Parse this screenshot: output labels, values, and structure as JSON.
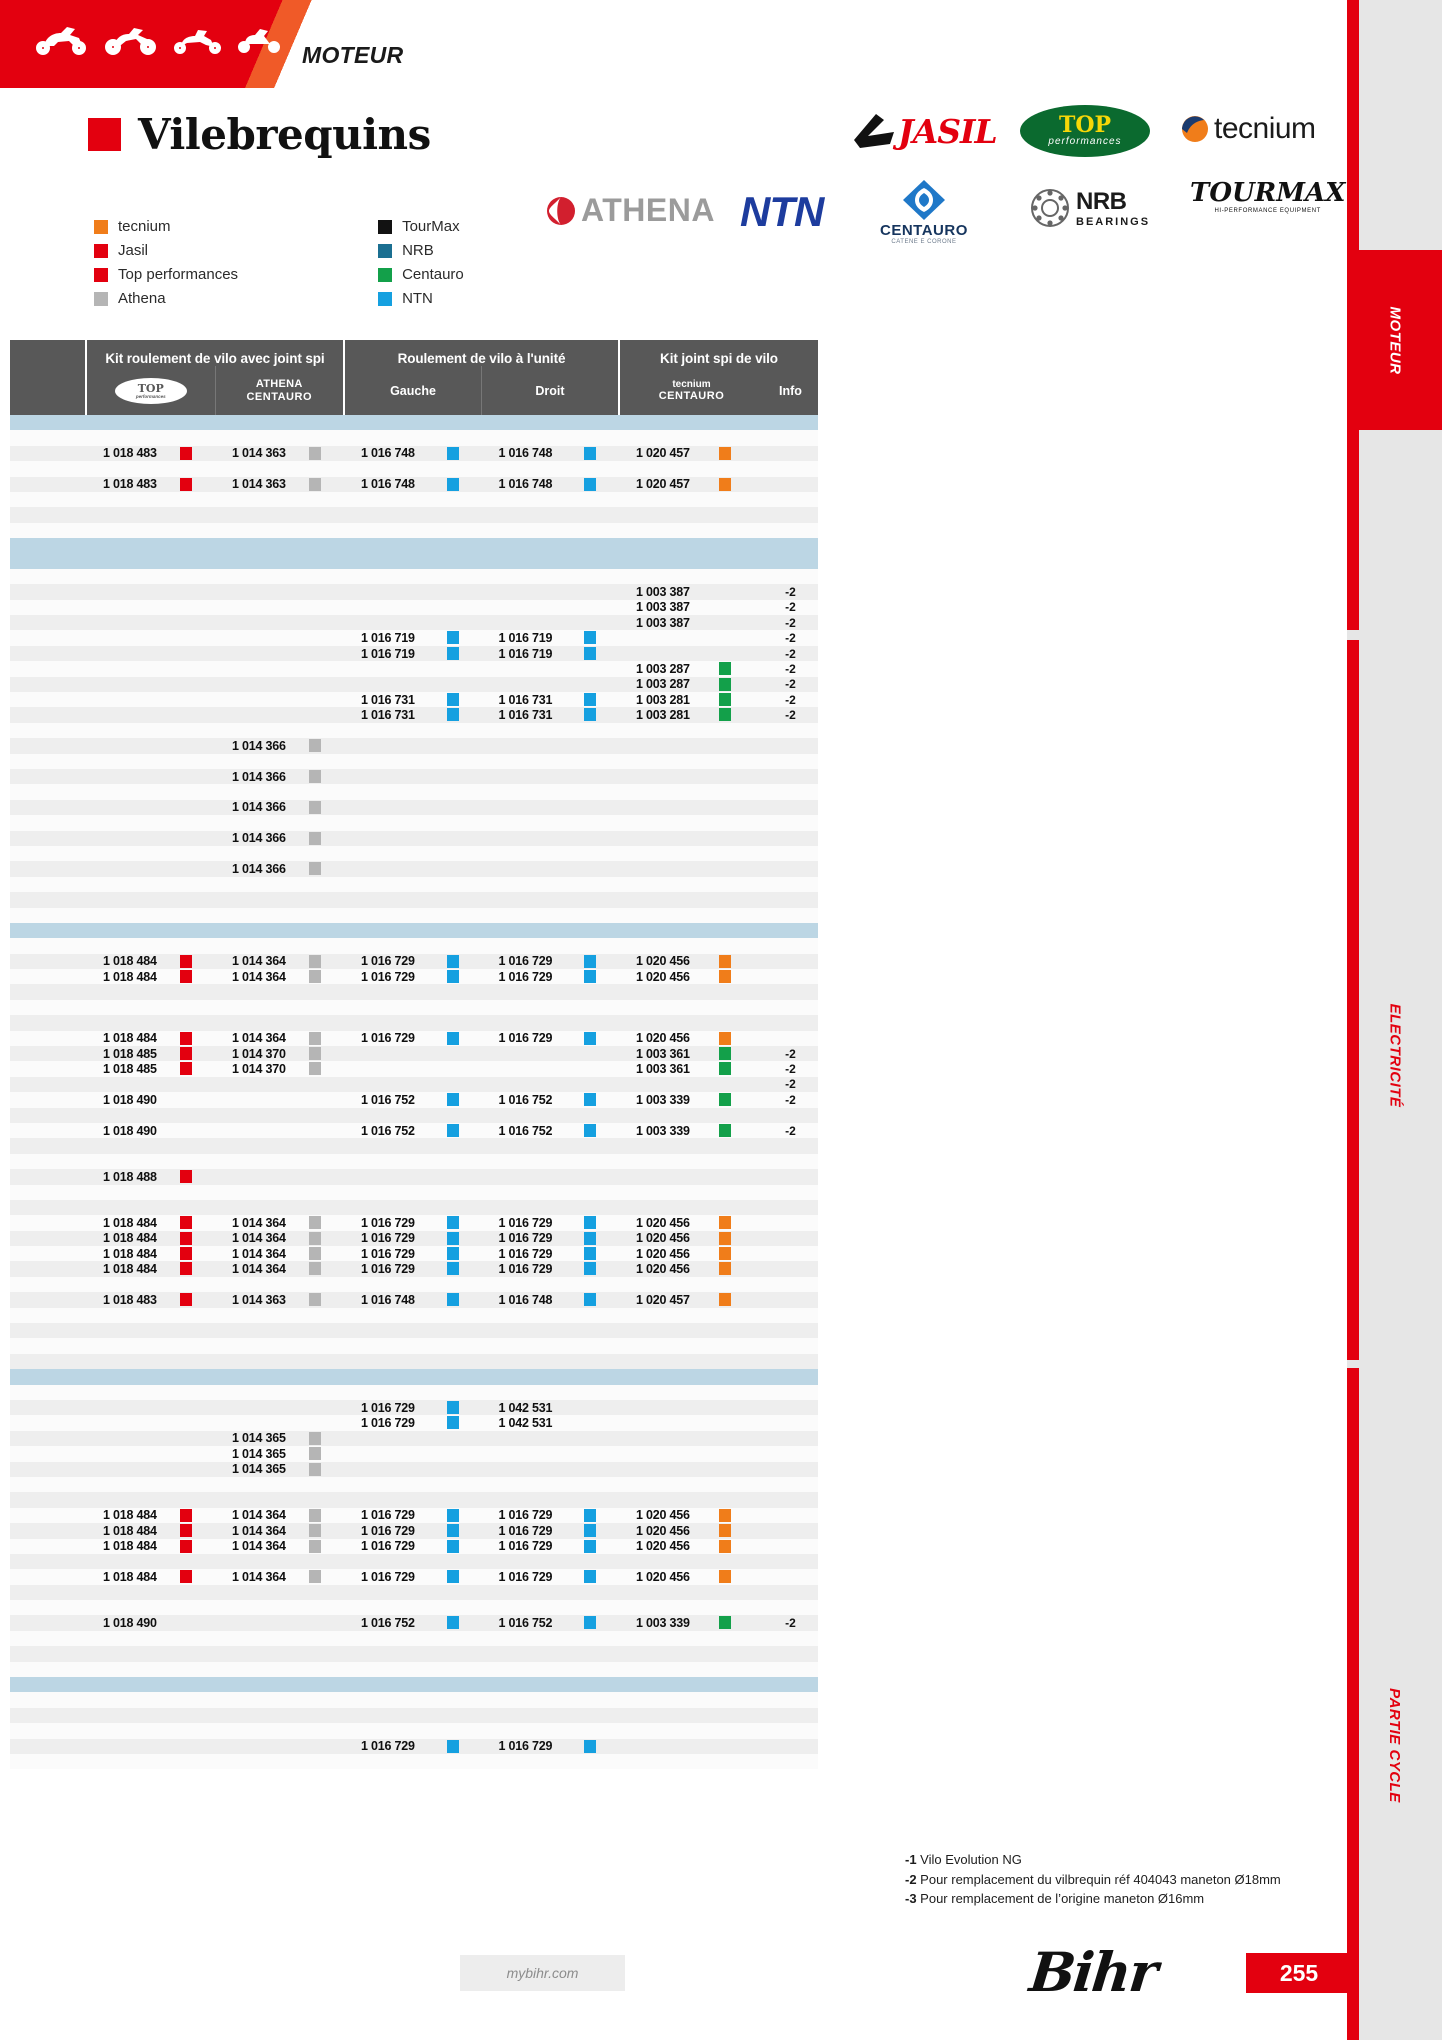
{
  "header": {
    "section_kicker": "MOTEUR",
    "title": "Vilebrequins",
    "accent_color": "#e3000f"
  },
  "legend": {
    "left": [
      {
        "label": "tecnium",
        "color": "#f07d1a"
      },
      {
        "label": "Jasil",
        "color": "#e3000f"
      },
      {
        "label": "Top performances",
        "color": "#e3000f"
      },
      {
        "label": "Athena",
        "color": "#b5b5b5"
      }
    ],
    "right": [
      {
        "label": "TourMax",
        "color": "#121212"
      },
      {
        "label": "NRB",
        "color": "#1b6f91"
      },
      {
        "label": "Centauro",
        "color": "#13a04a"
      },
      {
        "label": "NTN",
        "color": "#15a0e0"
      }
    ]
  },
  "brand_logos": [
    {
      "name": "jasil-logo",
      "text": "JASIL"
    },
    {
      "name": "top-performances-logo",
      "text": "TOP",
      "sub": "performances"
    },
    {
      "name": "tecnium-logo",
      "text": "tecnium"
    },
    {
      "name": "athena-logo",
      "text": "ATHENA"
    },
    {
      "name": "ntn-logo",
      "text": "NTN"
    },
    {
      "name": "centauro-logo",
      "text": "CENTAURO",
      "sub": "CATENE E CORONE"
    },
    {
      "name": "nrb-bearings-logo",
      "text": "NRB",
      "sub": "BEARINGS"
    },
    {
      "name": "tourmax-logo",
      "text": "TOURMAX",
      "sub": "HI-PERFORMANCE EQUIPMENT"
    }
  ],
  "table": {
    "group_headers": [
      {
        "label": ""
      },
      {
        "label": "Kit roulement de vilo avec joint spi"
      },
      {
        "label": "Roulement de vilo à l'unité"
      },
      {
        "label": "Kit joint spi de vilo"
      }
    ],
    "sub_headers": {
      "top_logo_main": "TOP",
      "top_logo_sub": "performances",
      "athena": "ATHENA",
      "centauro_1": "CENTAURO",
      "gauche": "Gauche",
      "droit": "Droit",
      "tecnium": "tecnium",
      "centauro_2": "CENTAURO",
      "info": "Info"
    },
    "rows": [
      {
        "style": "band-blue",
        "cells": {}
      },
      {
        "style": "plain",
        "cells": {}
      },
      {
        "style": "zebra",
        "cells": {
          "c1": "1 018 483",
          "c1c": "#e3000f",
          "c2": "1 014 363",
          "c2c": "#b5b5b5",
          "c3": "1 016 748",
          "c3c": "#15a0e0",
          "c4": "1 016 748",
          "c4c": "#15a0e0",
          "c5": "1 020 457",
          "c5c": "#f07d1a"
        }
      },
      {
        "style": "plain",
        "cells": {}
      },
      {
        "style": "zebra",
        "cells": {
          "c1": "1 018 483",
          "c1c": "#e3000f",
          "c2": "1 014 363",
          "c2c": "#b5b5b5",
          "c3": "1 016 748",
          "c3c": "#15a0e0",
          "c4": "1 016 748",
          "c4c": "#15a0e0",
          "c5": "1 020 457",
          "c5c": "#f07d1a"
        }
      },
      {
        "style": "plain",
        "cells": {}
      },
      {
        "style": "zebra",
        "cells": {}
      },
      {
        "style": "plain",
        "cells": {}
      },
      {
        "style": "band-blue",
        "cells": {}
      },
      {
        "style": "band-blue",
        "cells": {}
      },
      {
        "style": "plain",
        "cells": {}
      },
      {
        "style": "zebra",
        "cells": {
          "c5": "1 003 387",
          "c6": "-2"
        }
      },
      {
        "style": "plain",
        "cells": {
          "c5": "1 003 387",
          "c6": "-2"
        }
      },
      {
        "style": "zebra",
        "cells": {
          "c5": "1 003 387",
          "c6": "-2"
        }
      },
      {
        "style": "plain",
        "cells": {
          "c3": "1 016 719",
          "c3c": "#15a0e0",
          "c4": "1 016 719",
          "c4c": "#15a0e0",
          "c6": "-2"
        }
      },
      {
        "style": "zebra",
        "cells": {
          "c3": "1 016 719",
          "c3c": "#15a0e0",
          "c4": "1 016 719",
          "c4c": "#15a0e0",
          "c6": "-2"
        }
      },
      {
        "style": "plain",
        "cells": {
          "c5": "1 003 287",
          "c5c": "#13a04a",
          "c6": "-2"
        }
      },
      {
        "style": "zebra",
        "cells": {
          "c5": "1 003 287",
          "c5c": "#13a04a",
          "c6": "-2"
        }
      },
      {
        "style": "plain",
        "cells": {
          "c3": "1 016 731",
          "c3c": "#15a0e0",
          "c4": "1 016 731",
          "c4c": "#15a0e0",
          "c5": "1 003 281",
          "c5c": "#13a04a",
          "c6": "-2"
        }
      },
      {
        "style": "zebra",
        "cells": {
          "c3": "1 016 731",
          "c3c": "#15a0e0",
          "c4": "1 016 731",
          "c4c": "#15a0e0",
          "c5": "1 003 281",
          "c5c": "#13a04a",
          "c6": "-2"
        }
      },
      {
        "style": "plain",
        "cells": {}
      },
      {
        "style": "zebra",
        "cells": {
          "c2": "1 014 366",
          "c2c": "#b5b5b5"
        }
      },
      {
        "style": "plain",
        "cells": {}
      },
      {
        "style": "zebra",
        "cells": {
          "c2": "1 014 366",
          "c2c": "#b5b5b5"
        }
      },
      {
        "style": "plain",
        "cells": {}
      },
      {
        "style": "zebra",
        "cells": {
          "c2": "1 014 366",
          "c2c": "#b5b5b5"
        }
      },
      {
        "style": "plain",
        "cells": {}
      },
      {
        "style": "zebra",
        "cells": {
          "c2": "1 014 366",
          "c2c": "#b5b5b5"
        }
      },
      {
        "style": "plain",
        "cells": {}
      },
      {
        "style": "zebra",
        "cells": {
          "c2": "1 014 366",
          "c2c": "#b5b5b5"
        }
      },
      {
        "style": "plain",
        "cells": {}
      },
      {
        "style": "zebra",
        "cells": {}
      },
      {
        "style": "plain",
        "cells": {}
      },
      {
        "style": "band-blue",
        "cells": {}
      },
      {
        "style": "plain",
        "cells": {}
      },
      {
        "style": "zebra",
        "cells": {
          "c1": "1 018 484",
          "c1c": "#e3000f",
          "c2": "1 014 364",
          "c2c": "#b5b5b5",
          "c3": "1 016 729",
          "c3c": "#15a0e0",
          "c4": "1 016 729",
          "c4c": "#15a0e0",
          "c5": "1 020 456",
          "c5c": "#f07d1a"
        }
      },
      {
        "style": "plain",
        "cells": {
          "c1": "1 018 484",
          "c1c": "#e3000f",
          "c2": "1 014 364",
          "c2c": "#b5b5b5",
          "c3": "1 016 729",
          "c3c": "#15a0e0",
          "c4": "1 016 729",
          "c4c": "#15a0e0",
          "c5": "1 020 456",
          "c5c": "#f07d1a"
        }
      },
      {
        "style": "zebra",
        "cells": {}
      },
      {
        "style": "plain",
        "cells": {}
      },
      {
        "style": "zebra",
        "cells": {}
      },
      {
        "style": "plain",
        "cells": {
          "c1": "1 018 484",
          "c1c": "#e3000f",
          "c2": "1 014 364",
          "c2c": "#b5b5b5",
          "c3": "1 016 729",
          "c3c": "#15a0e0",
          "c4": "1 016 729",
          "c4c": "#15a0e0",
          "c5": "1 020 456",
          "c5c": "#f07d1a"
        }
      },
      {
        "style": "zebra",
        "cells": {
          "c1": "1 018 485",
          "c1c": "#e3000f",
          "c2": "1 014 370",
          "c2c": "#b5b5b5",
          "c5": "1 003 361",
          "c5c": "#13a04a",
          "c6": "-2"
        }
      },
      {
        "style": "plain",
        "cells": {
          "c1": "1 018 485",
          "c1c": "#e3000f",
          "c2": "1 014 370",
          "c2c": "#b5b5b5",
          "c5": "1 003 361",
          "c5c": "#13a04a",
          "c6": "-2"
        }
      },
      {
        "style": "zebra",
        "cells": {
          "c6": "-2"
        }
      },
      {
        "style": "plain",
        "cells": {
          "c1": "1 018 490",
          "c3": "1 016 752",
          "c3c": "#15a0e0",
          "c4": "1 016 752",
          "c4c": "#15a0e0",
          "c5": "1 003 339",
          "c5c": "#13a04a",
          "c6": "-2"
        }
      },
      {
        "style": "zebra",
        "cells": {}
      },
      {
        "style": "plain",
        "cells": {
          "c1": "1 018 490",
          "c3": "1 016 752",
          "c3c": "#15a0e0",
          "c4": "1 016 752",
          "c4c": "#15a0e0",
          "c5": "1 003 339",
          "c5c": "#13a04a",
          "c6": "-2"
        }
      },
      {
        "style": "zebra",
        "cells": {}
      },
      {
        "style": "plain",
        "cells": {}
      },
      {
        "style": "zebra",
        "cells": {
          "c1": "1 018 488",
          "c1c": "#e3000f"
        }
      },
      {
        "style": "plain",
        "cells": {}
      },
      {
        "style": "zebra",
        "cells": {}
      },
      {
        "style": "plain",
        "cells": {
          "c1": "1 018 484",
          "c1c": "#e3000f",
          "c2": "1 014 364",
          "c2c": "#b5b5b5",
          "c3": "1 016 729",
          "c3c": "#15a0e0",
          "c4": "1 016 729",
          "c4c": "#15a0e0",
          "c5": "1 020 456",
          "c5c": "#f07d1a"
        }
      },
      {
        "style": "zebra",
        "cells": {
          "c1": "1 018 484",
          "c1c": "#e3000f",
          "c2": "1 014 364",
          "c2c": "#b5b5b5",
          "c3": "1 016 729",
          "c3c": "#15a0e0",
          "c4": "1 016 729",
          "c4c": "#15a0e0",
          "c5": "1 020 456",
          "c5c": "#f07d1a"
        }
      },
      {
        "style": "plain",
        "cells": {
          "c1": "1 018 484",
          "c1c": "#e3000f",
          "c2": "1 014 364",
          "c2c": "#b5b5b5",
          "c3": "1 016 729",
          "c3c": "#15a0e0",
          "c4": "1 016 729",
          "c4c": "#15a0e0",
          "c5": "1 020 456",
          "c5c": "#f07d1a"
        }
      },
      {
        "style": "zebra",
        "cells": {
          "c1": "1 018 484",
          "c1c": "#e3000f",
          "c2": "1 014 364",
          "c2c": "#b5b5b5",
          "c3": "1 016 729",
          "c3c": "#15a0e0",
          "c4": "1 016 729",
          "c4c": "#15a0e0",
          "c5": "1 020 456",
          "c5c": "#f07d1a"
        }
      },
      {
        "style": "plain",
        "cells": {}
      },
      {
        "style": "zebra",
        "cells": {
          "c1": "1 018 483",
          "c1c": "#e3000f",
          "c2": "1 014 363",
          "c2c": "#b5b5b5",
          "c3": "1 016 748",
          "c3c": "#15a0e0",
          "c4": "1 016 748",
          "c4c": "#15a0e0",
          "c5": "1 020 457",
          "c5c": "#f07d1a"
        }
      },
      {
        "style": "plain",
        "cells": {}
      },
      {
        "style": "zebra",
        "cells": {}
      },
      {
        "style": "plain",
        "cells": {}
      },
      {
        "style": "zebra",
        "cells": {}
      },
      {
        "style": "band-blue",
        "cells": {}
      },
      {
        "style": "plain",
        "cells": {}
      },
      {
        "style": "zebra",
        "cells": {
          "c3": "1 016 729",
          "c3c": "#15a0e0",
          "c4": "1 042 531"
        }
      },
      {
        "style": "plain",
        "cells": {
          "c3": "1 016 729",
          "c3c": "#15a0e0",
          "c4": "1 042 531"
        }
      },
      {
        "style": "zebra",
        "cells": {
          "c2": "1 014 365",
          "c2c": "#b5b5b5"
        }
      },
      {
        "style": "plain",
        "cells": {
          "c2": "1 014 365",
          "c2c": "#b5b5b5"
        }
      },
      {
        "style": "zebra",
        "cells": {
          "c2": "1 014 365",
          "c2c": "#b5b5b5"
        }
      },
      {
        "style": "plain",
        "cells": {}
      },
      {
        "style": "zebra",
        "cells": {}
      },
      {
        "style": "plain",
        "cells": {
          "c1": "1 018 484",
          "c1c": "#e3000f",
          "c2": "1 014 364",
          "c2c": "#b5b5b5",
          "c3": "1 016 729",
          "c3c": "#15a0e0",
          "c4": "1 016 729",
          "c4c": "#15a0e0",
          "c5": "1 020 456",
          "c5c": "#f07d1a"
        }
      },
      {
        "style": "zebra",
        "cells": {
          "c1": "1 018 484",
          "c1c": "#e3000f",
          "c2": "1 014 364",
          "c2c": "#b5b5b5",
          "c3": "1 016 729",
          "c3c": "#15a0e0",
          "c4": "1 016 729",
          "c4c": "#15a0e0",
          "c5": "1 020 456",
          "c5c": "#f07d1a"
        }
      },
      {
        "style": "plain",
        "cells": {
          "c1": "1 018 484",
          "c1c": "#e3000f",
          "c2": "1 014 364",
          "c2c": "#b5b5b5",
          "c3": "1 016 729",
          "c3c": "#15a0e0",
          "c4": "1 016 729",
          "c4c": "#15a0e0",
          "c5": "1 020 456",
          "c5c": "#f07d1a"
        }
      },
      {
        "style": "zebra",
        "cells": {}
      },
      {
        "style": "plain",
        "cells": {
          "c1": "1 018 484",
          "c1c": "#e3000f",
          "c2": "1 014 364",
          "c2c": "#b5b5b5",
          "c3": "1 016 729",
          "c3c": "#15a0e0",
          "c4": "1 016 729",
          "c4c": "#15a0e0",
          "c5": "1 020 456",
          "c5c": "#f07d1a"
        }
      },
      {
        "style": "zebra",
        "cells": {}
      },
      {
        "style": "plain",
        "cells": {}
      },
      {
        "style": "zebra",
        "cells": {
          "c1": "1 018 490",
          "c3": "1 016 752",
          "c3c": "#15a0e0",
          "c4": "1 016 752",
          "c4c": "#15a0e0",
          "c5": "1 003 339",
          "c5c": "#13a04a",
          "c6": "-2"
        }
      },
      {
        "style": "plain",
        "cells": {}
      },
      {
        "style": "zebra",
        "cells": {}
      },
      {
        "style": "plain",
        "cells": {}
      },
      {
        "style": "band-blue",
        "cells": {}
      },
      {
        "style": "plain",
        "cells": {}
      },
      {
        "style": "zebra",
        "cells": {}
      },
      {
        "style": "plain",
        "cells": {}
      },
      {
        "style": "zebra",
        "cells": {
          "c3": "1 016 729",
          "c3c": "#15a0e0",
          "c4": "1 016 729",
          "c4c": "#15a0e0"
        }
      },
      {
        "style": "plain",
        "cells": {}
      }
    ]
  },
  "footnotes": [
    {
      "marker": "-1",
      "text": "Vilo Evolution NG"
    },
    {
      "marker": "-2",
      "text": "Pour remplacement du vilbrequin réf 404043 maneton Ø18mm"
    },
    {
      "marker": "-3",
      "text": "Pour remplacement de l’origine maneton Ø16mm"
    }
  ],
  "footer": {
    "website": "mybihr.com",
    "brand": "Bihr",
    "page_number": "255"
  },
  "rail_tabs": [
    {
      "label": "MOTEUR",
      "active": true
    },
    {
      "label": "ELECTRICITÉ",
      "active": false
    },
    {
      "label": "PARTIE CYCLE",
      "active": false
    }
  ]
}
